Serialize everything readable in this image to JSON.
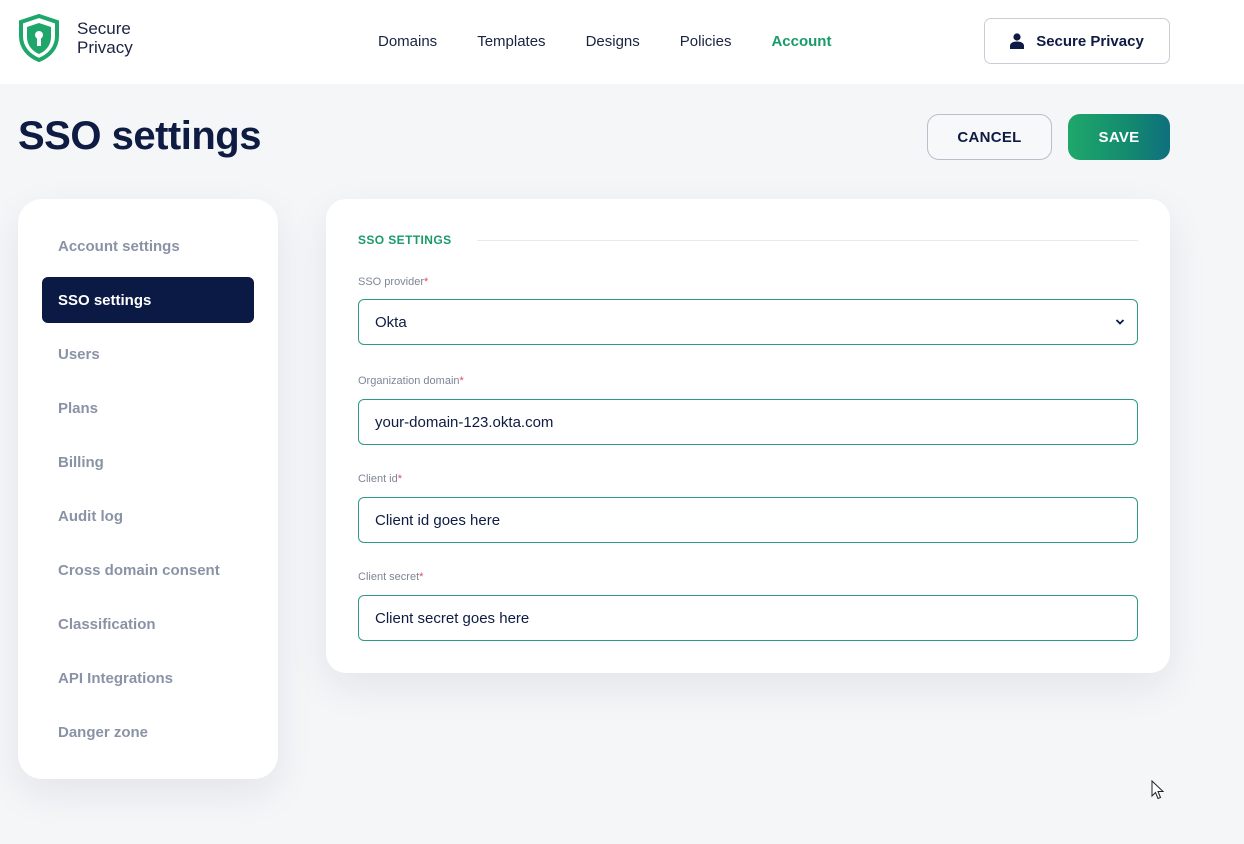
{
  "brand": {
    "line1": "Secure",
    "line2": "Privacy",
    "accent": "#1a9a69"
  },
  "nav": {
    "items": [
      {
        "label": "Domains"
      },
      {
        "label": "Templates"
      },
      {
        "label": "Designs"
      },
      {
        "label": "Policies"
      },
      {
        "label": "Account",
        "active": true
      }
    ]
  },
  "user": {
    "label": "Secure Privacy",
    "icon": "user-icon"
  },
  "page": {
    "title": "SSO settings"
  },
  "actions": {
    "cancel": "CANCEL",
    "save": "SAVE"
  },
  "sidebar": {
    "items": [
      {
        "label": "Account settings"
      },
      {
        "label": "SSO settings",
        "active": true
      },
      {
        "label": "Users"
      },
      {
        "label": "Plans"
      },
      {
        "label": "Billing"
      },
      {
        "label": "Audit log"
      },
      {
        "label": "Cross domain consent"
      },
      {
        "label": "Classification"
      },
      {
        "label": "API Integrations"
      },
      {
        "label": "Danger zone"
      }
    ]
  },
  "form": {
    "section_title": "SSO SETTINGS",
    "required_mark": "*",
    "provider": {
      "label": "SSO provider",
      "value": "Okta"
    },
    "domain": {
      "label": "Organization domain",
      "value": "your-domain-123.okta.com"
    },
    "client_id": {
      "label": "Client id",
      "value": "Client id goes here"
    },
    "client_secret": {
      "label": "Client secret",
      "value": "Client secret goes here"
    }
  }
}
